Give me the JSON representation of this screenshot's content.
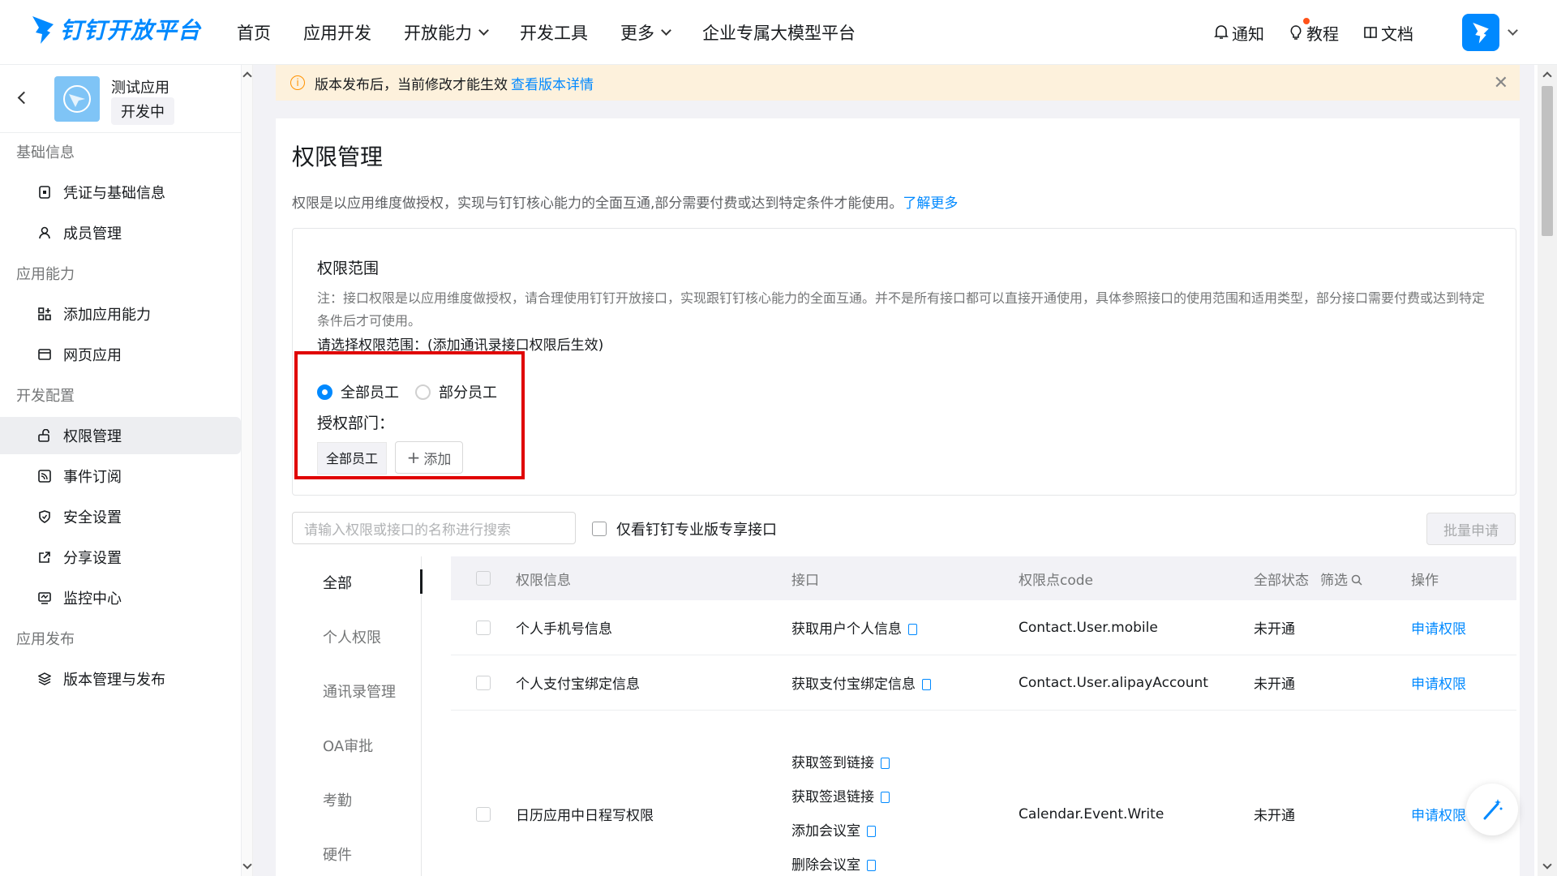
{
  "brand": {
    "name": "钉钉开放平台",
    "accent": "#0089ff"
  },
  "nav": [
    {
      "label": "首页",
      "dropdown": false
    },
    {
      "label": "应用开发",
      "dropdown": false
    },
    {
      "label": "开放能力",
      "dropdown": true
    },
    {
      "label": "开发工具",
      "dropdown": false
    },
    {
      "label": "更多",
      "dropdown": true
    },
    {
      "label": "企业专属大模型平台",
      "dropdown": false
    }
  ],
  "tools": {
    "notify": "通知",
    "tutorial": "教程",
    "docs": "文档"
  },
  "app": {
    "name": "测试应用",
    "status": "开发中"
  },
  "sidebar": {
    "sections": [
      {
        "title": "基础信息",
        "items": [
          {
            "label": "凭证与基础信息",
            "icon": "credential-icon"
          },
          {
            "label": "成员管理",
            "icon": "user-icon"
          }
        ]
      },
      {
        "title": "应用能力",
        "items": [
          {
            "label": "添加应用能力",
            "icon": "grid-add-icon"
          },
          {
            "label": "网页应用",
            "icon": "browser-icon"
          }
        ]
      },
      {
        "title": "开发配置",
        "items": [
          {
            "label": "权限管理",
            "icon": "lock-icon",
            "active": true
          },
          {
            "label": "事件订阅",
            "icon": "rss-icon"
          },
          {
            "label": "安全设置",
            "icon": "shield-icon"
          },
          {
            "label": "分享设置",
            "icon": "share-icon"
          },
          {
            "label": "监控中心",
            "icon": "monitor-icon"
          }
        ]
      },
      {
        "title": "应用发布",
        "items": [
          {
            "label": "版本管理与发布",
            "icon": "layers-icon"
          }
        ]
      }
    ]
  },
  "notice": {
    "text": "版本发布后，当前修改才能生效",
    "link": "查看版本详情"
  },
  "page": {
    "title": "权限管理",
    "desc": "权限是以应用维度做授权，实现与钉钉核心能力的全面互通,部分需要付费或达到特定条件才能使用。",
    "desc_link": "了解更多"
  },
  "scope": {
    "title": "权限范围",
    "note": "注：接口权限是以应用维度做授权，请合理使用钉钉开放接口，实现跟钉钉核心能力的全面互通。并不是所有接口都可以直接开通使用，具体参照接口的使用范围和适用类型，部分接口需要付费或达到特定条件后才可使用。",
    "select_label": "请选择权限范围：(添加通讯录接口权限后生效)",
    "radio_all": "全部员工",
    "radio_part": "部分员工",
    "selected": "全部员工",
    "dept_label": "授权部门：",
    "dept_tag": "全部员工",
    "add_label": "添加"
  },
  "search": {
    "placeholder": "请输入权限或接口的名称进行搜索"
  },
  "pro_only": "仅看钉钉专业版专享接口",
  "batch_apply": "批量申请",
  "categories": [
    "全部",
    "个人权限",
    "通讯录管理",
    "OA审批",
    "考勤",
    "硬件"
  ],
  "table": {
    "headers": {
      "info": "权限信息",
      "api": "接口",
      "code": "权限点code",
      "status": "全部状态",
      "filter": "筛选",
      "action": "操作"
    },
    "rows": [
      {
        "info": "个人手机号信息",
        "apis": [
          "获取用户个人信息"
        ],
        "code": "Contact.User.mobile",
        "status": "未开通",
        "action": "申请权限"
      },
      {
        "info": "个人支付宝绑定信息",
        "apis": [
          "获取支付宝绑定信息"
        ],
        "code": "Contact.User.alipayAccount",
        "status": "未开通",
        "action": "申请权限"
      },
      {
        "info": "日历应用中日程写权限",
        "apis": [
          "获取签到链接",
          "获取签退链接",
          "添加会议室",
          "删除会议室"
        ],
        "code": "Calendar.Event.Write",
        "status": "未开通",
        "action": "申请权限"
      }
    ]
  }
}
